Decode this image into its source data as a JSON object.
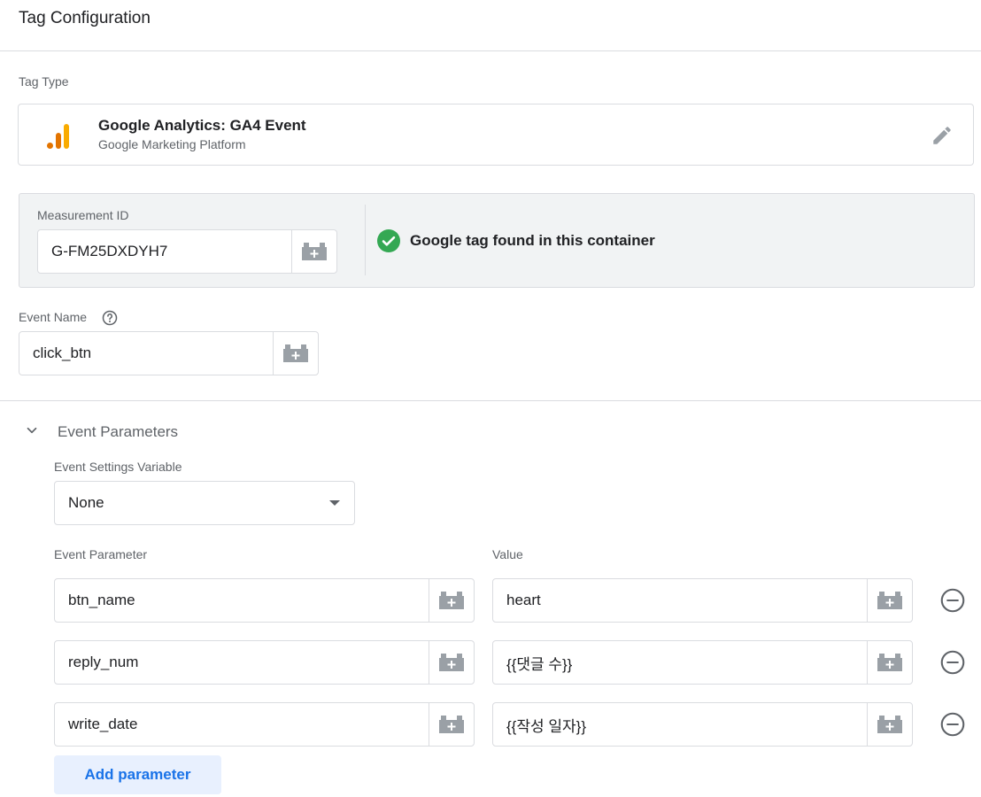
{
  "header": {
    "title": "Tag Configuration"
  },
  "tag_type": {
    "label": "Tag Type",
    "name": "Google Analytics: GA4 Event",
    "subtitle": "Google Marketing Platform",
    "icon": "google-analytics-icon"
  },
  "measurement": {
    "label": "Measurement ID",
    "value": "G-FM25DXDYH7",
    "status_text": "Google tag found in this container",
    "status_icon": "check-circle-icon",
    "status_color": "#34a853"
  },
  "event_name": {
    "label": "Event Name",
    "value": "click_btn"
  },
  "event_parameters": {
    "section_title": "Event Parameters",
    "settings_variable_label": "Event Settings Variable",
    "settings_variable_value": "None",
    "param_header": "Event Parameter",
    "value_header": "Value",
    "rows": [
      {
        "param": "btn_name",
        "value": "heart"
      },
      {
        "param": "reply_num",
        "value": "{{댓글 수}}"
      },
      {
        "param": "write_date",
        "value": "{{작성 일자}}"
      }
    ],
    "add_label": "Add parameter"
  },
  "colors": {
    "accent": "#1a73e8",
    "ga_orange": "#f9ab00",
    "ga_dark": "#e37400"
  }
}
